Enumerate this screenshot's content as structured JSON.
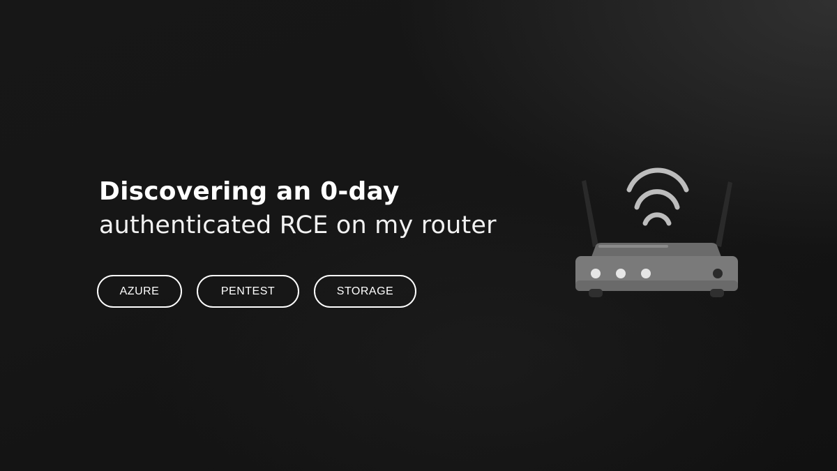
{
  "post": {
    "title_line1": "Discovering an 0-day",
    "title_line2": "authenticated RCE on my router"
  },
  "tags": [
    {
      "label": "AZURE"
    },
    {
      "label": "PENTEST"
    },
    {
      "label": "STORAGE"
    }
  ],
  "illustration": {
    "icon": "wifi-router-icon"
  },
  "colors": {
    "background": "#141414",
    "text": "#ffffff",
    "router_body": "#7a7a7a",
    "router_dark": "#5e5e5e",
    "wifi_waves": "#bdbdbd"
  }
}
